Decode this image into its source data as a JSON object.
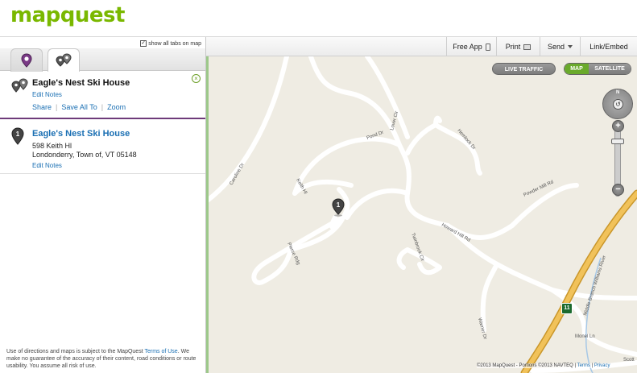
{
  "header": {
    "logo": "mapquest"
  },
  "left_panel": {
    "show_all_tabs_label": "show all tabs on map",
    "show_all_tabs_checked": true,
    "tabs": [
      {
        "name": "single-location",
        "active": false
      },
      {
        "name": "multi-location",
        "active": true
      }
    ],
    "group_card": {
      "title": "Eagle's Nest Ski House",
      "edit_notes": "Edit Notes",
      "actions": [
        "Share",
        "Save All To",
        "Zoom"
      ],
      "separator": "|"
    },
    "location_card": {
      "number": "1",
      "title": "Eagle's Nest Ski House",
      "address_line1": "598 Keith Hl",
      "address_line2": "Londonderry, Town of, VT 05148",
      "edit_notes": "Edit Notes"
    },
    "disclaimer": {
      "before_link": "Use of directions and maps is subject to the MapQuest ",
      "link": "Terms of Use",
      "after_link": ". We make no guarantee of the accuracy of their content, road conditions or route usability. You assume all risk of use."
    }
  },
  "map_toolbar": {
    "free_app": "Free App",
    "print": "Print",
    "send": "Send",
    "link_embed": "Link/Embed"
  },
  "map_controls": {
    "live_traffic": "LIVE TRAFFIC",
    "map": "MAP",
    "satellite": "SATELLITE",
    "compass_n": "N",
    "zoom_in": "+",
    "zoom_out": "−"
  },
  "map": {
    "pin_number": "1",
    "highway_shield": "11",
    "road_labels": [
      "Caroline Dr",
      "Pond Dr",
      "Lover Cir",
      "Hemlock Dr",
      "Keith Hl",
      "Powder Mill Rd",
      "Howard Hill Rd",
      "Twinbrook Cir",
      "Pierce Rdg",
      "Warner Dr",
      "Middle Branch Williams River",
      "Monel Ln",
      "Scott"
    ]
  },
  "copyright": {
    "text": "©2013 MapQuest - Portions ©2013 NAVTEQ |",
    "terms": "Terms",
    "privacy": "Privacy"
  },
  "colors": {
    "brand_green": "#7ab800",
    "link_blue": "#1a6fb3",
    "divider_purple": "#6e3b7a",
    "map_background": "#efece3",
    "highway": "#e8b94a"
  }
}
